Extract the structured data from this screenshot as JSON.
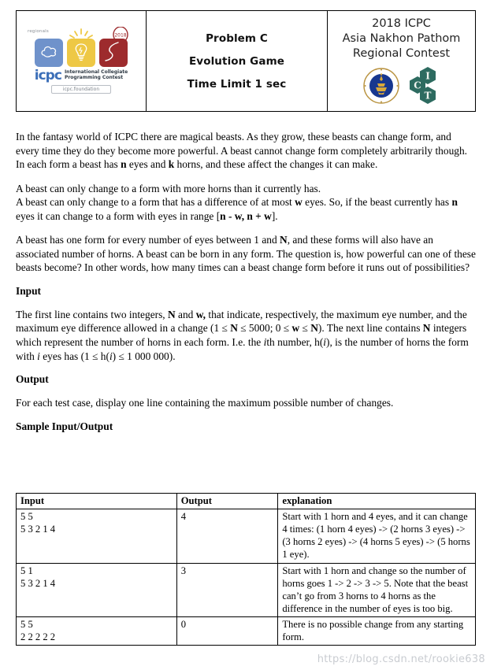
{
  "header": {
    "logo_panel": {
      "regionals_label": "regionals",
      "balloon_year": "2018",
      "icpc_wordmark": "icpc",
      "icpc_subtitle_line1": "International Collegiate",
      "icpc_subtitle_line2": "Programming Contest",
      "foundation_label": "icpc.foundation"
    },
    "middle_panel": {
      "lines": [
        "Problem C",
        "Evolution Game",
        "Time Limit 1 sec"
      ]
    },
    "right_panel": {
      "title_lines": [
        "2018 ICPC",
        "Asia Nakhon Pathom",
        "Regional Contest"
      ],
      "ict_letters": [
        "I",
        "C",
        "T"
      ]
    }
  },
  "body": {
    "p1_a": "In the fantasy world of ICPC there are magical beasts. As they grow, these beasts can change form, and every time they do they become more powerful. A beast cannot change form completely arbitrarily though. In each form a beast has ",
    "p1_n": "n",
    "p1_b": " eyes and ",
    "p1_k": "k",
    "p1_c": " horns, and these affect the changes it can make.",
    "p2_line1": "A beast can only change to a form with more horns than it currently has.",
    "p2_line2_a": "A beast can only change to a form that has a difference of at most ",
    "p2_w": "w",
    "p2_line2_b": " eyes. So, if the beast currently has ",
    "p2_n": "n",
    "p2_line2_c": " eyes it can change to a form with eyes in range [",
    "p2_range": "n - w, n + w",
    "p2_line2_d": "].",
    "p3_a": "A beast has one form for every number of eyes between 1 and ",
    "p3_N": "N",
    "p3_b": ", and these forms will also have an associated number of horns. A beast can be born in any form. The question is, how powerful can one of these beasts become? In other words, how many times can a beast change form before it runs out of possibilities?",
    "input_heading": "Input",
    "input_a": "The first line contains two integers, ",
    "input_N": "N",
    "input_b": " and ",
    "input_w": "w,",
    "input_c": " that indicate, respectively, the maximum eye number, and the maximum eye difference allowed in a change (1 ≤ ",
    "input_N2": "N",
    "input_d": " ≤ 5000; 0 ≤ ",
    "input_w2": "w",
    "input_e": " ≤ ",
    "input_N3": "N",
    "input_f": "). The next line contains ",
    "input_N4": "N",
    "input_g": " integers which represent the number of horns in each form. I.e. the ",
    "input_ith": "i",
    "input_h": "th number, h(",
    "input_i2": "i",
    "input_j": "), is the number of horns the form with ",
    "input_i3": "i",
    "input_k": " eyes has (1 ≤ h(",
    "input_i4": "i",
    "input_l": ") ≤ 1 000 000).",
    "output_heading": "Output",
    "output_text": "For each test case, display one line containing the maximum possible number of changes.",
    "sample_heading": "Sample Input/Output"
  },
  "sample_table": {
    "headers": [
      "Input",
      "Output",
      "explanation"
    ],
    "rows": [
      {
        "input": "5 5\n5 3 2 1 4",
        "output": "4",
        "explanation": "Start with 1 horn and 4 eyes, and it can change 4 times: (1 horn 4 eyes) -> (2 horns 3 eyes) -> (3 horns 2 eyes) -> (4 horns 5 eyes) -> (5 horns 1 eye)."
      },
      {
        "input": "5 1\n5 3 2 1 4",
        "output": "3",
        "explanation": "Start with 1 horn and change so the number of horns goes 1 -> 2 -> 3 -> 5. Note that the beast can’t go from 3 horns to 4 horns as the difference in the number of eyes is too big."
      },
      {
        "input": "5 5\n2 2 2 2 2",
        "output": "0",
        "explanation": "There is no possible change from any starting form."
      }
    ]
  },
  "watermark": "https://blog.csdn.net/rookie638"
}
